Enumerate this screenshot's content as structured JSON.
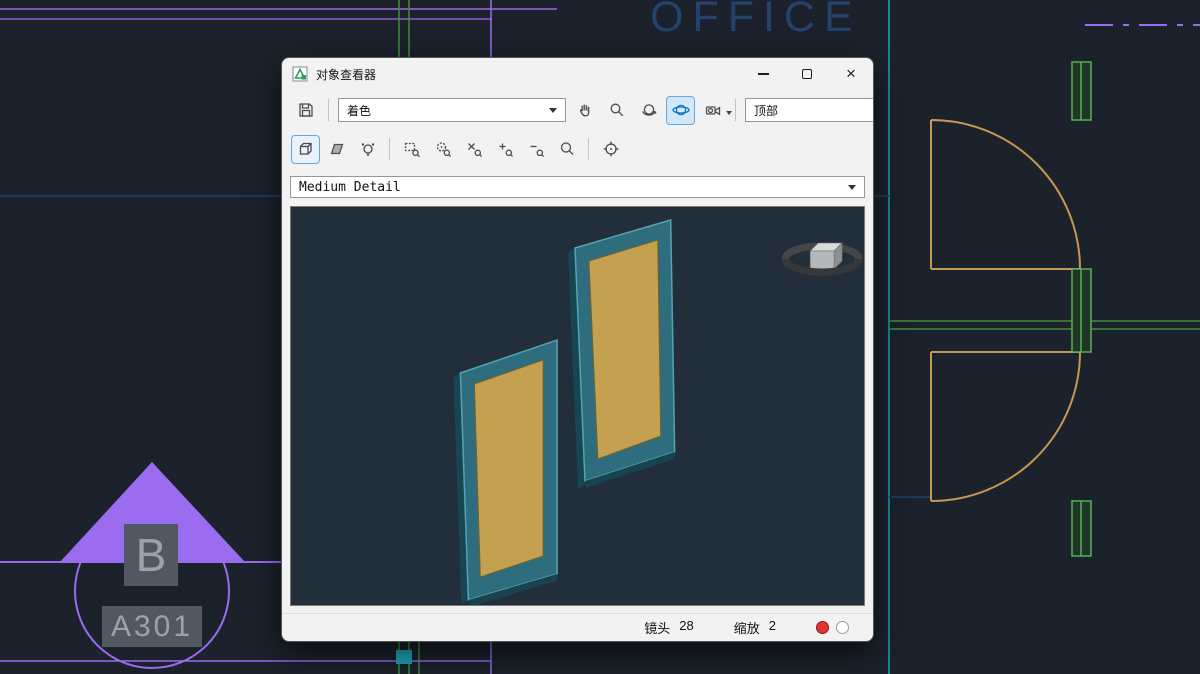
{
  "window": {
    "title": "对象查看器",
    "close_glyph": "×"
  },
  "toolbar": {
    "style_value": "着色",
    "view_value": "顶部",
    "detail_value": "Medium Detail"
  },
  "statusbar": {
    "lens_label": "镜头",
    "lens_value": "28",
    "zoom_label": "缩放",
    "zoom_value": "2"
  },
  "drawing": {
    "room_label": "OFFICE",
    "marker_letter": "B",
    "marker_code": "A301"
  },
  "icons": {
    "row1": [
      "save-icon",
      "pan-icon",
      "zoom-realtime-icon",
      "orbit-icon",
      "constrained-orbit-icon",
      "swivel-camera-icon"
    ],
    "row2": [
      "wireframe-box-icon",
      "shaded-face-icon",
      "visual-style-icon",
      "zoom-window-icon",
      "zoom-center-icon",
      "zoom-object-icon",
      "zoom-in-icon",
      "zoom-out-icon",
      "zoom-all-icon",
      "center-target-icon"
    ]
  },
  "colors": {
    "accent_purple": "#9b6cf0",
    "cad_green": "#3f8f3f",
    "cad_tan": "#c99552",
    "cad_cyan": "#1fa8b8",
    "room_label_blue": "#24426e",
    "panel_frame_teal": "#2d6d7e",
    "panel_fill_tan": "#c3a151",
    "active_tool_blue": "#0d74c4",
    "status_red": "#e23333"
  }
}
